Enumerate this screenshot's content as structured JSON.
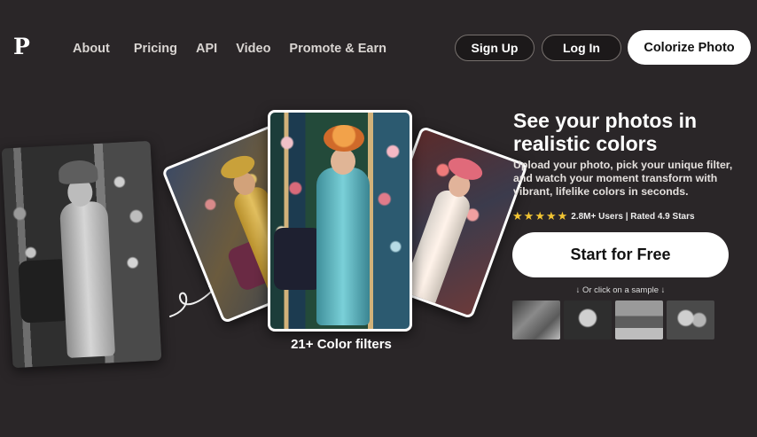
{
  "header": {
    "logo": "P",
    "nav": [
      "About",
      "Pricing",
      "API",
      "Video",
      "Promote & Earn"
    ],
    "signup_label": "Sign Up",
    "login_label": "Log In",
    "colorize_label": "Colorize Photo"
  },
  "showcase": {
    "filters_label": "21+ Color filters"
  },
  "hero": {
    "title": "See your photos in realistic colors",
    "description": "Upload your photo, pick your unique filter, and watch your moment transform with vibrant, lifelike colors in seconds.",
    "stars": 5,
    "rating_text": "2.8M+ Users | Rated 4.9 Stars",
    "start_label": "Start for Free",
    "sample_hint": "↓ Or click on a sample ↓"
  },
  "colors": {
    "background": "#2a2628",
    "star": "#f2c533",
    "button_light": "#ffffff"
  }
}
